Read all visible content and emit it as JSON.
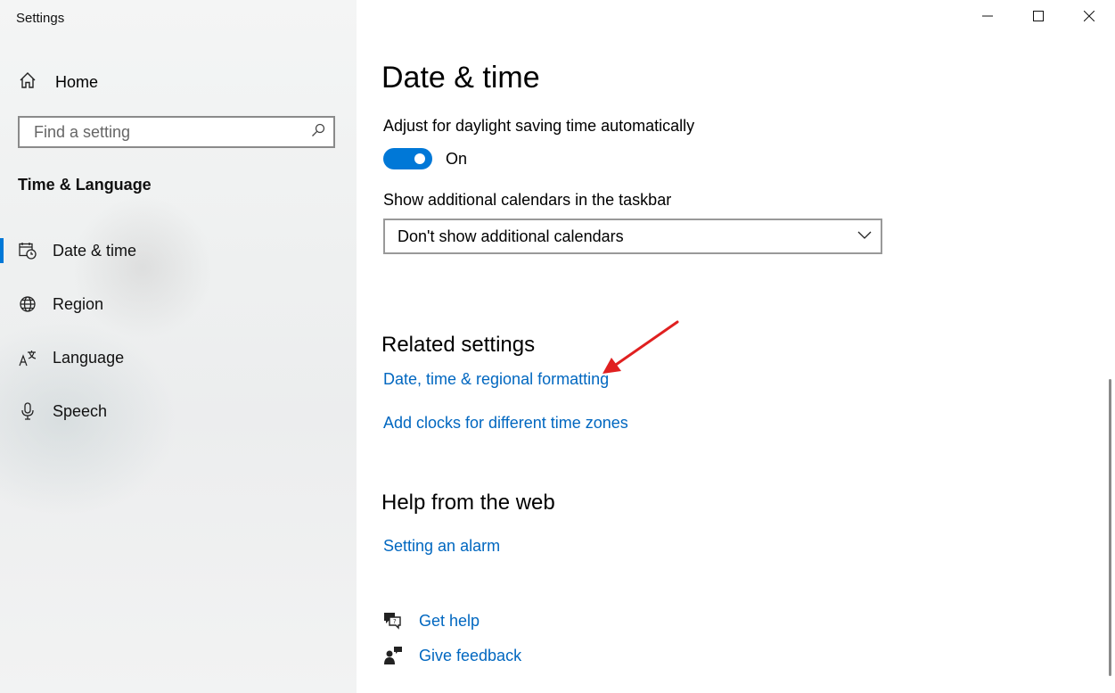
{
  "window": {
    "title": "Settings",
    "controls": [
      "minimize",
      "maximize",
      "close"
    ]
  },
  "sidebar": {
    "home_label": "Home",
    "search_placeholder": "Find a setting",
    "section_title": "Time & Language",
    "items": [
      {
        "label": "Date & time",
        "icon": "calendar-clock-icon",
        "selected": true
      },
      {
        "label": "Region",
        "icon": "globe-icon",
        "selected": false
      },
      {
        "label": "Language",
        "icon": "language-icon",
        "selected": false
      },
      {
        "label": "Speech",
        "icon": "microphone-icon",
        "selected": false
      }
    ]
  },
  "main": {
    "title": "Date & time",
    "dst": {
      "label": "Adjust for daylight saving time automatically",
      "state": "On",
      "enabled": true
    },
    "calendars": {
      "label": "Show additional calendars in the taskbar",
      "selected": "Don't show additional calendars"
    },
    "related": {
      "heading": "Related settings",
      "links": [
        "Date, time & regional formatting",
        "Add clocks for different time zones"
      ]
    },
    "help_web": {
      "heading": "Help from the web",
      "links": [
        "Setting an alarm"
      ]
    },
    "support": {
      "get_help": "Get help",
      "give_feedback": "Give feedback"
    }
  },
  "colors": {
    "accent": "#0078d7",
    "link": "#0067c0",
    "annotation_arrow": "#e02020"
  }
}
